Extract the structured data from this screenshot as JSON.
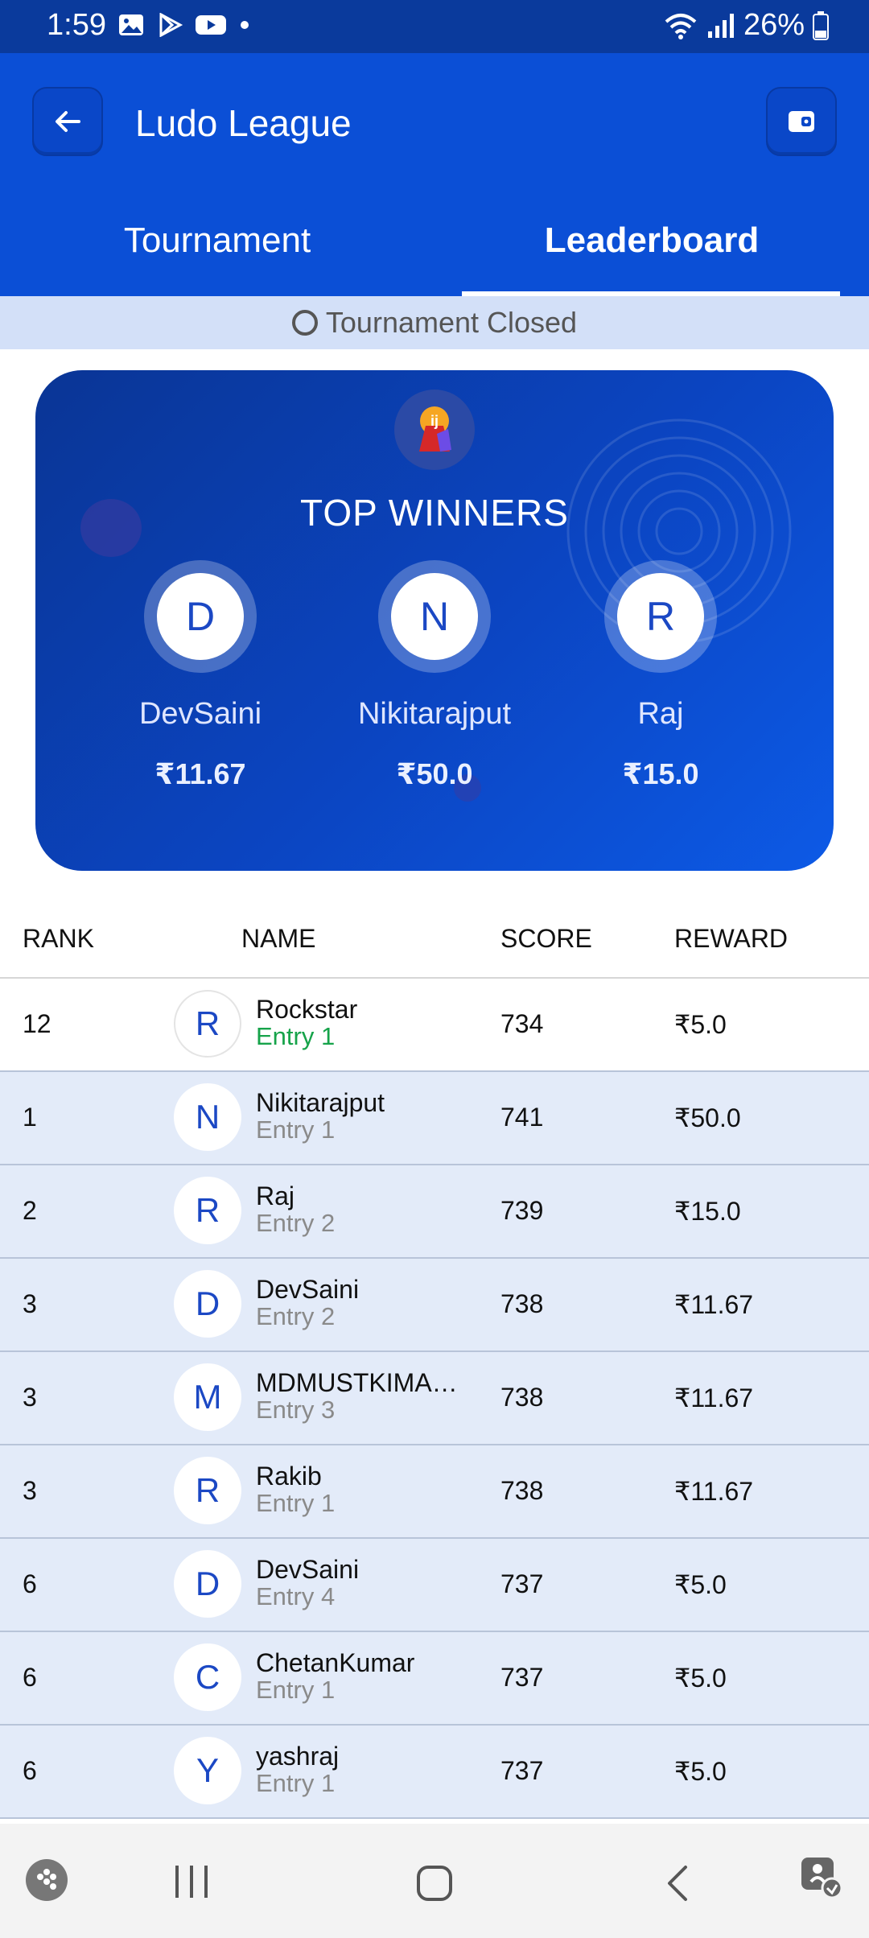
{
  "status_bar": {
    "time": "1:59",
    "battery": "26%"
  },
  "header": {
    "title": "Ludo League"
  },
  "tabs": [
    {
      "label": "Tournament"
    },
    {
      "label": "Leaderboard"
    }
  ],
  "banner": {
    "text": "Tournament Closed"
  },
  "winners_card": {
    "title": "TOP WINNERS",
    "winners": [
      {
        "initial": "D",
        "name": "DevSaini",
        "amount": "₹11.67"
      },
      {
        "initial": "N",
        "name": "Nikitarajput",
        "amount": "₹50.0"
      },
      {
        "initial": "R",
        "name": "Raj",
        "amount": "₹15.0"
      }
    ]
  },
  "table": {
    "headers": {
      "rank": "RANK",
      "name": "NAME",
      "score": "SCORE",
      "reward": "REWARD"
    },
    "rows": [
      {
        "rank": "12",
        "initial": "R",
        "name": "Rockstar",
        "entry": "Entry 1",
        "score": "734",
        "reward": "₹5.0"
      },
      {
        "rank": "1",
        "initial": "N",
        "name": "Nikitarajput",
        "entry": "Entry 1",
        "score": "741",
        "reward": "₹50.0"
      },
      {
        "rank": "2",
        "initial": "R",
        "name": "Raj",
        "entry": "Entry 2",
        "score": "739",
        "reward": "₹15.0"
      },
      {
        "rank": "3",
        "initial": "D",
        "name": "DevSaini",
        "entry": "Entry 2",
        "score": "738",
        "reward": "₹11.67"
      },
      {
        "rank": "3",
        "initial": "M",
        "name": "MDMUSTKIMANS...",
        "entry": "Entry 3",
        "score": "738",
        "reward": "₹11.67"
      },
      {
        "rank": "3",
        "initial": "R",
        "name": "Rakib",
        "entry": "Entry 1",
        "score": "738",
        "reward": "₹11.67"
      },
      {
        "rank": "6",
        "initial": "D",
        "name": "DevSaini",
        "entry": "Entry 4",
        "score": "737",
        "reward": "₹5.0"
      },
      {
        "rank": "6",
        "initial": "C",
        "name": "ChetanKumar",
        "entry": "Entry 1",
        "score": "737",
        "reward": "₹5.0"
      },
      {
        "rank": "6",
        "initial": "Y",
        "name": "yashraj",
        "entry": "Entry 1",
        "score": "737",
        "reward": "₹5.0"
      }
    ]
  },
  "colors": {
    "primary": "#0b4fd6",
    "status_bar": "#0a3a9c",
    "highlight_row": "#e3ebf9",
    "entry_green": "#16a34a"
  },
  "icons": [
    "gallery-icon",
    "play-store-icon",
    "youtube-icon",
    "wifi-icon",
    "signal-icon",
    "battery-icon",
    "back-arrow-icon",
    "wallet-icon",
    "trophy-icon",
    "game-launcher-icon",
    "recents-icon",
    "home-icon",
    "nav-back-icon",
    "accessibility-icon"
  ]
}
